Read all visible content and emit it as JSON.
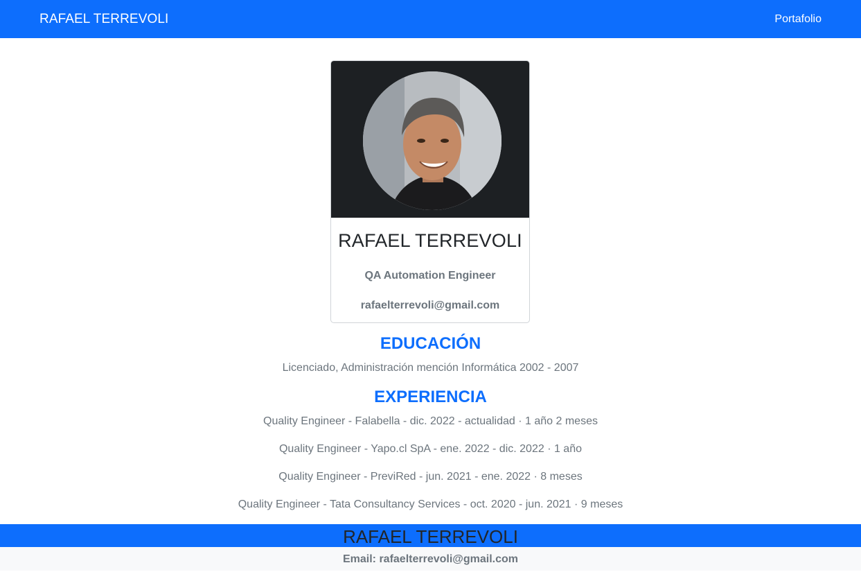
{
  "navbar": {
    "brand": "RAFAEL TERREVOLI",
    "link": "Portafolio"
  },
  "profile": {
    "name": "RAFAEL TERREVOLI",
    "role": "QA Automation Engineer",
    "email": "rafaelterrevoli@gmail.com"
  },
  "education": {
    "title": "EDUCACIÓN",
    "items": [
      "Licenciado, Administración mención Informática 2002 - 2007"
    ]
  },
  "experience": {
    "title": "EXPERIENCIA",
    "items": [
      "Quality Engineer - Falabella - dic. 2022 - actualidad · 1 año 2 meses",
      "Quality Engineer - Yapo.cl SpA - ene. 2022 - dic. 2022 · 1 año",
      "Quality Engineer - PreviRed - jun. 2021 - ene. 2022 · 8 meses",
      "Quality Engineer - Tata Consultancy Services - oct. 2020 - jun. 2021 · 9 meses"
    ]
  },
  "footer": {
    "name": "RAFAEL TERREVOLI",
    "email": "Email: rafaelterrevoli@gmail.com"
  }
}
